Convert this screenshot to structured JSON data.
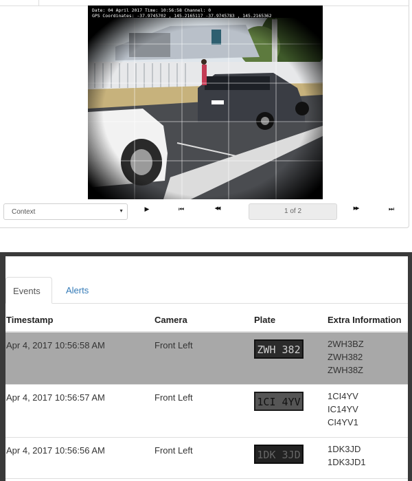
{
  "viewer": {
    "overlay": {
      "line1": "Date: 04 April 2017 Time: 10:56:58 Channel: 0",
      "line2": "GPS Coordinates: -37.9745702 , 145.2165117 -37.9745783 , 145.2165362"
    },
    "context_select": {
      "selected": "Context"
    },
    "controls": {
      "play_icon": "▶",
      "first_icon": "⏮",
      "rewind_icon": "◀◀",
      "forward_icon": "▶▶",
      "last_icon": "⏭"
    },
    "page_indicator": "1 of 2"
  },
  "events_panel": {
    "tabs": [
      {
        "label": "Events",
        "active": true
      },
      {
        "label": "Alerts",
        "active": false
      }
    ],
    "columns": [
      "Timestamp",
      "Camera",
      "Plate",
      "Extra Information"
    ],
    "rows": [
      {
        "timestamp": "Apr 4, 2017 10:56:58 AM",
        "camera": "Front Left",
        "plate": "ZWH 382",
        "extra": [
          "2WH3BZ",
          "ZWH382",
          "ZWH38Z"
        ],
        "highlighted": true
      },
      {
        "timestamp": "Apr 4, 2017 10:56:57 AM",
        "camera": "Front Left",
        "plate": "1CI 4YV",
        "extra": [
          "1CI4YV",
          "IC14YV",
          "CI4YV1"
        ],
        "highlighted": false
      },
      {
        "timestamp": "Apr 4, 2017 10:56:56 AM",
        "camera": "Front Left",
        "plate": "1DK 3JD",
        "extra": [
          "1DK3JD",
          "1DK3JD1"
        ],
        "highlighted": false
      }
    ]
  },
  "colors": {
    "link": "#337ab7",
    "row_highlight": "#a8a8a8",
    "panel_frame": "#3a3a3a"
  }
}
